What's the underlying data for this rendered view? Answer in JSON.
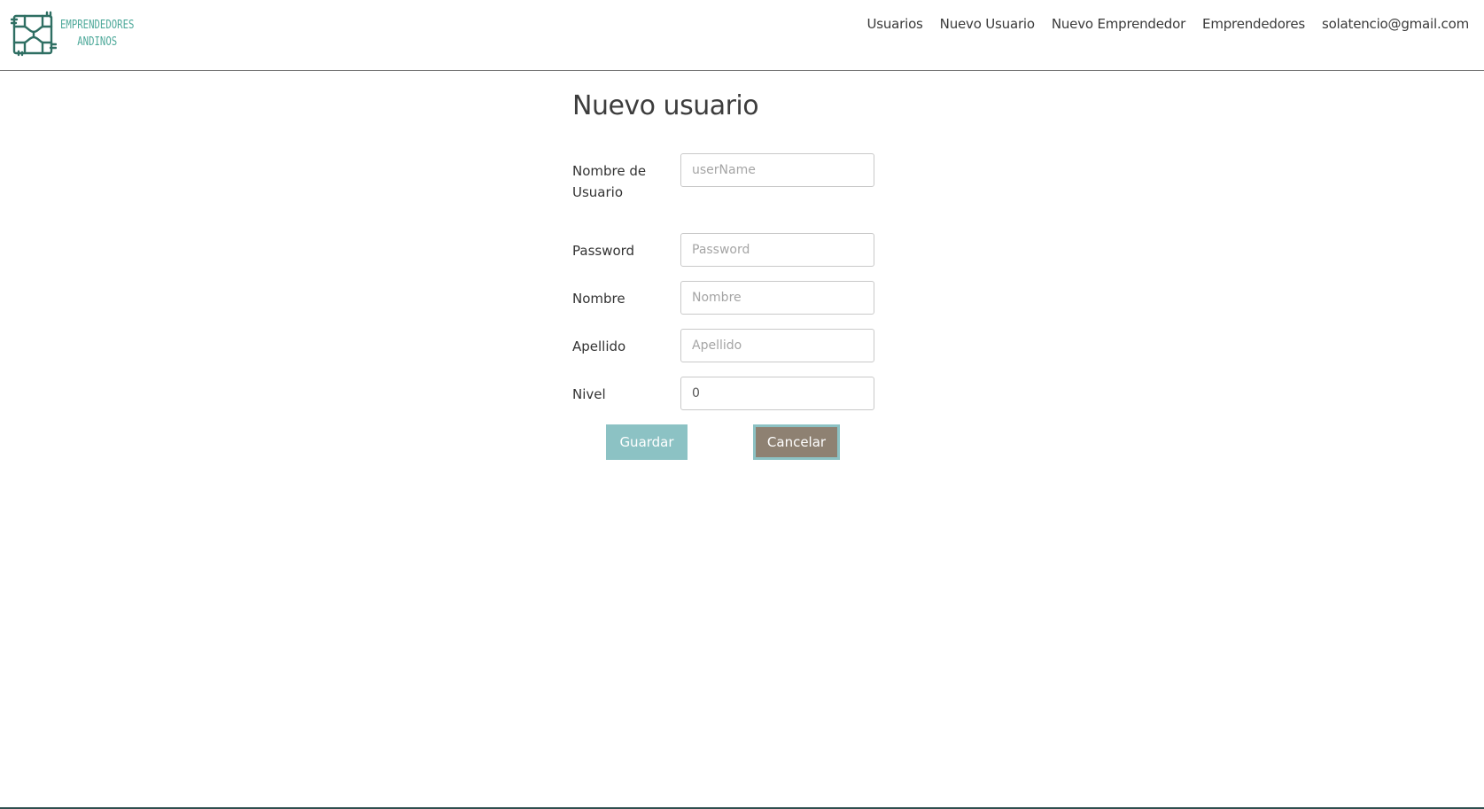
{
  "brand": {
    "line1": "EMPRENDEDORES",
    "line2": "ANDINOS",
    "color": "#4ea99a"
  },
  "nav": {
    "items": [
      {
        "label": "Usuarios"
      },
      {
        "label": "Nuevo Usuario"
      },
      {
        "label": "Nuevo Emprendedor"
      },
      {
        "label": "Emprendedores"
      },
      {
        "label": "solatencio@gmail.com"
      }
    ]
  },
  "page": {
    "title": "Nuevo usuario"
  },
  "form": {
    "username": {
      "label": "Nombre de Usuario",
      "placeholder": "userName",
      "value": ""
    },
    "password": {
      "label": "Password",
      "placeholder": "Password",
      "value": ""
    },
    "nombre": {
      "label": "Nombre",
      "placeholder": "Nombre",
      "value": ""
    },
    "apellido": {
      "label": "Apellido",
      "placeholder": "Apellido",
      "value": ""
    },
    "nivel": {
      "label": "Nivel",
      "placeholder": "",
      "value": "0"
    }
  },
  "buttons": {
    "save_label": "Guardar",
    "cancel_label": "Cancelar",
    "save_color": "#8cc2c4",
    "cancel_color": "#8e8172"
  }
}
